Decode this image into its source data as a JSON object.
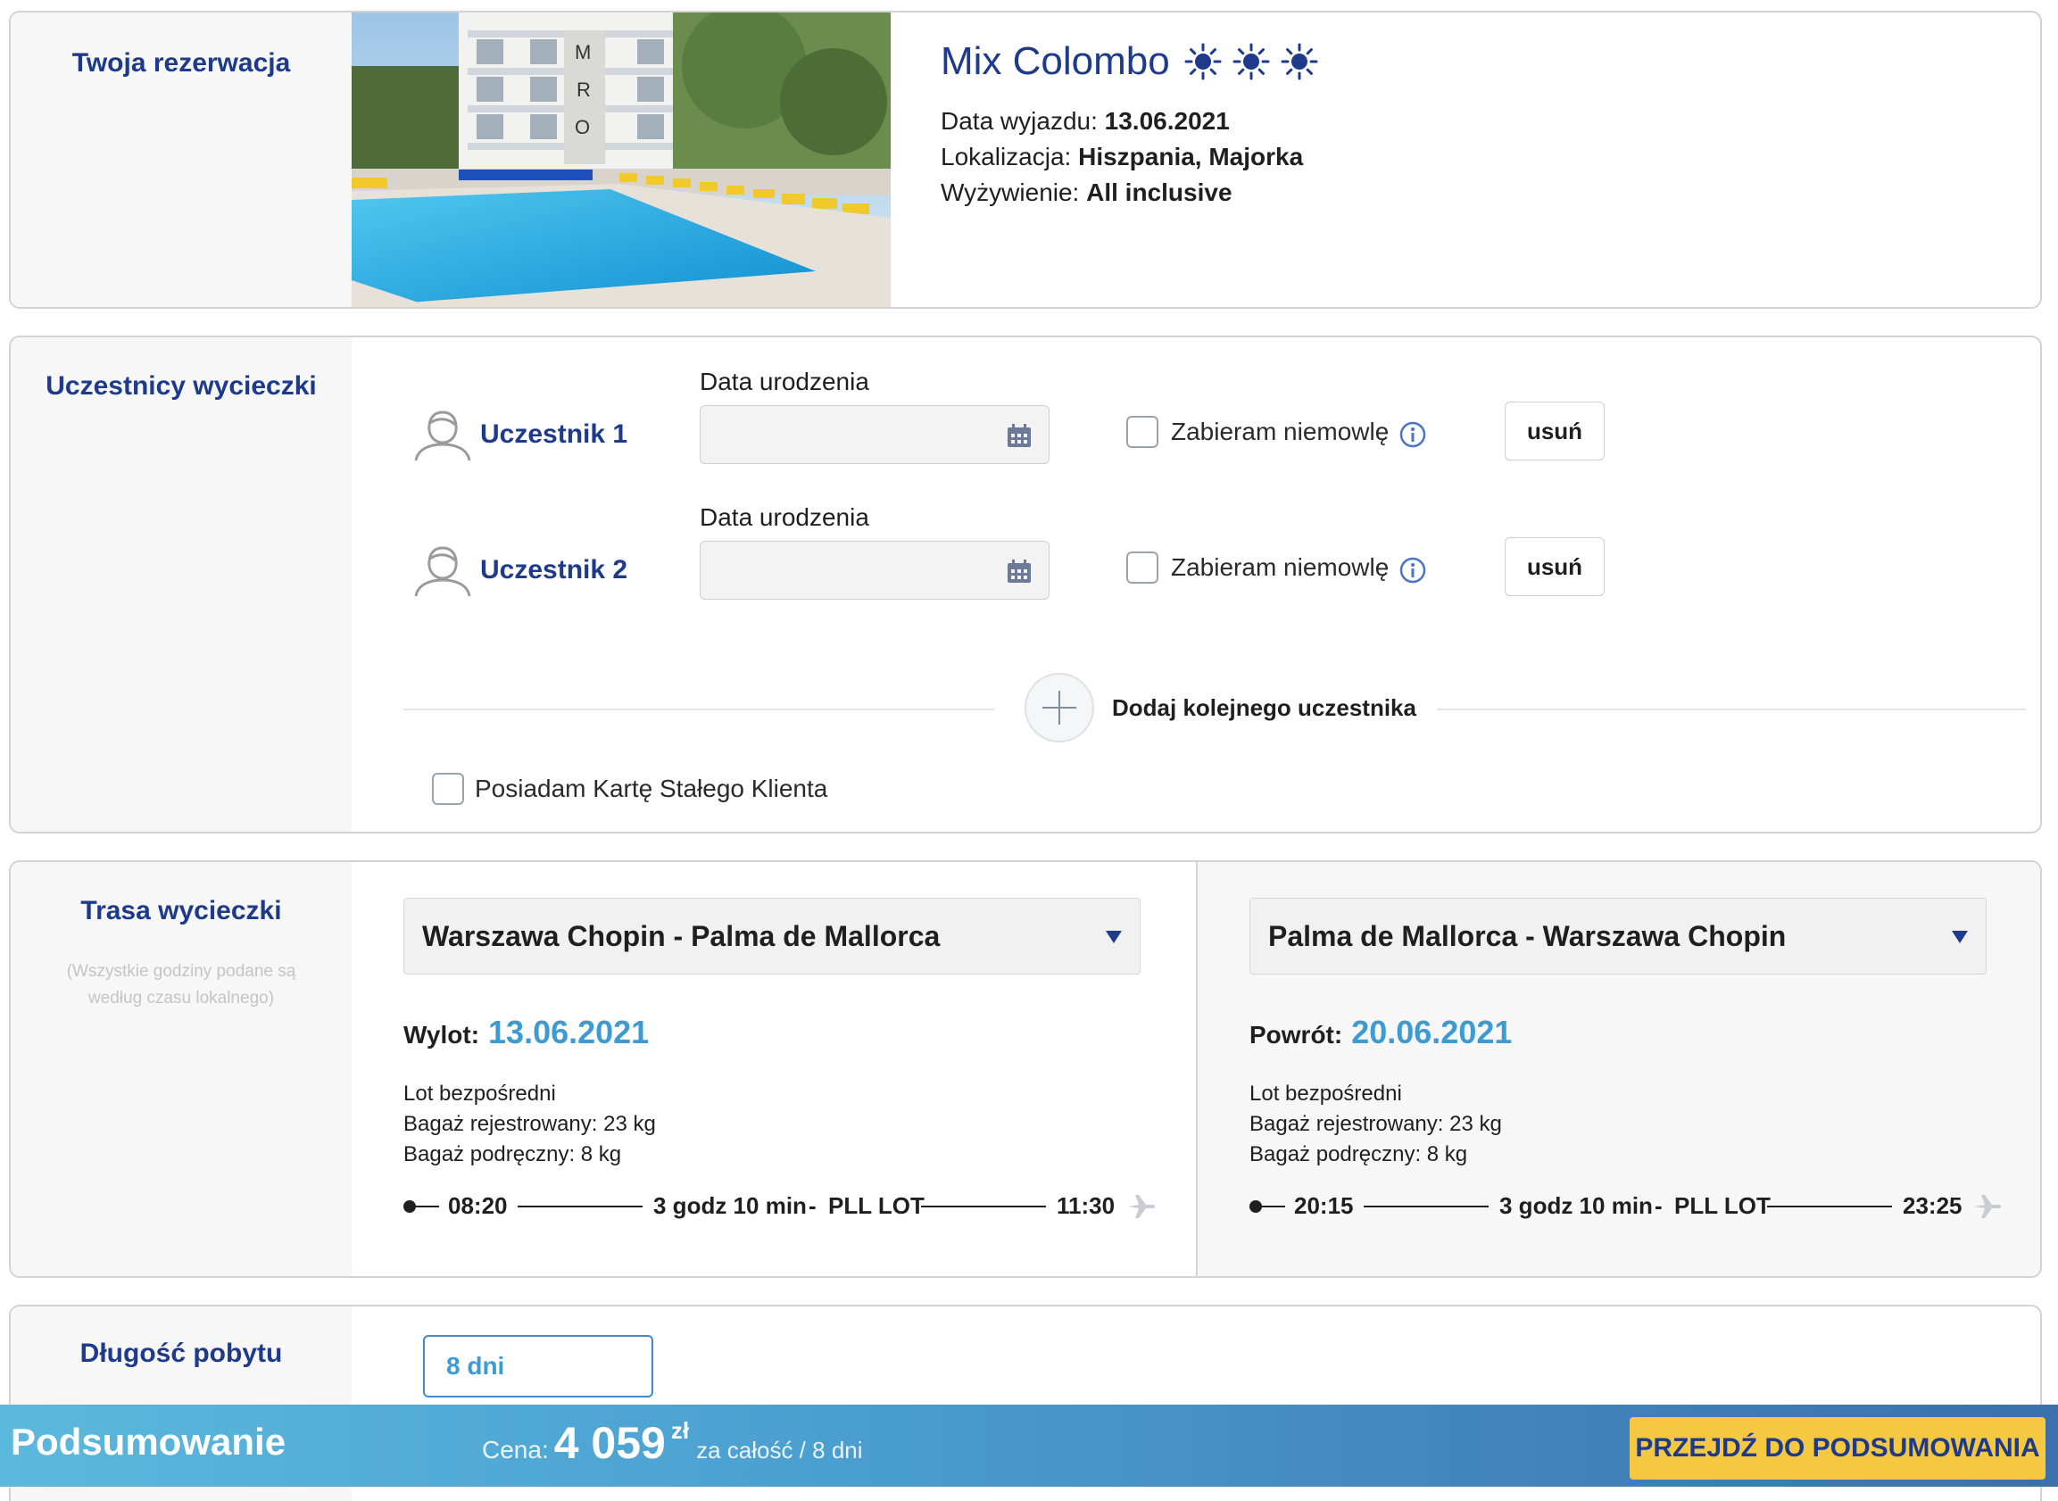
{
  "booking": {
    "section_title": "Twoja rezerwacja",
    "hotel_name": "Mix Colombo",
    "rating_icon": "sun-icon",
    "rating_count": 3,
    "departure_label": "Data wyjazdu:",
    "departure_value": "13.06.2021",
    "location_label": "Lokalizacja:",
    "location_value": "Hiszpania, Majorka",
    "board_label": "Wyżywienie:",
    "board_value": "All inclusive",
    "sign_letters": [
      "M",
      "R",
      "O"
    ]
  },
  "participants": {
    "section_title": "Uczestnicy wycieczki",
    "items": [
      {
        "name": "Uczestnik 1",
        "dob_label": "Data urodzenia",
        "dob_value": "",
        "infant_label": "Zabieram niemowlę",
        "remove_label": "usuń"
      },
      {
        "name": "Uczestnik 2",
        "dob_label": "Data urodzenia",
        "dob_value": "",
        "infant_label": "Zabieram niemowlę",
        "remove_label": "usuń"
      }
    ],
    "add_label": "Dodaj kolejnego uczestnika",
    "loyalty_label": "Posiadam Kartę Stałego Klienta"
  },
  "route": {
    "section_title": "Trasa wycieczki",
    "note": "(Wszystkie godziny podane są według czasu lokalnego)",
    "outbound": {
      "select_value": "Warszawa Chopin - Palma de Mallorca",
      "date_label": "Wylot:",
      "date_value": "13.06.2021",
      "direct": "Lot bezpośredni",
      "checked_baggage": "Bagaż rejestrowany: 23 kg",
      "cabin_baggage": "Bagaż podręczny: 8 kg",
      "dep_time": "08:20",
      "duration": "3 godz 10 min",
      "separator": "-",
      "carrier": "PLL LOT",
      "arr_time": "11:30"
    },
    "inbound": {
      "select_value": "Palma de Mallorca - Warszawa Chopin",
      "date_label": "Powrót:",
      "date_value": "20.06.2021",
      "direct": "Lot bezpośredni",
      "checked_baggage": "Bagaż rejestrowany: 23 kg",
      "cabin_baggage": "Bagaż podręczny: 8 kg",
      "dep_time": "20:15",
      "duration": "3 godz 10 min",
      "separator": "-",
      "carrier": "PLL LOT",
      "arr_time": "23:25"
    }
  },
  "stay": {
    "section_title": "Długość pobytu",
    "value": "8 dni"
  },
  "summary": {
    "title": "Podsumowanie",
    "price_label": "Cena:",
    "price_value": "4 059",
    "currency": "zł",
    "price_note": "za całość / 8 dni",
    "cta_label": "PRZEJDŹ DO PODSUMOWANIA"
  },
  "colors": {
    "brand_navy": "#1e3a8a",
    "accent_blue": "#3d9bd4",
    "cta_yellow": "#f5c842"
  }
}
